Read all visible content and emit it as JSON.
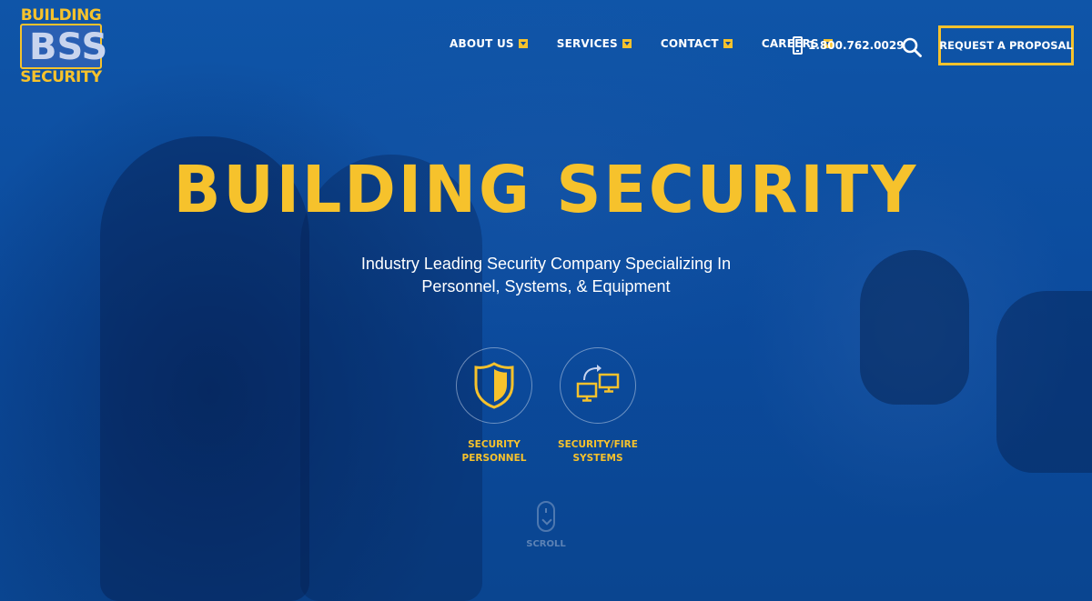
{
  "logo": {
    "top_text": "BUILDING",
    "monogram": "BSS",
    "bottom_text": "SECURITY"
  },
  "nav": {
    "items": [
      {
        "label": "ABOUT US"
      },
      {
        "label": "SERVICES"
      },
      {
        "label": "CONTACT"
      },
      {
        "label": "CAREERS"
      }
    ],
    "phone": "1.800.762.0029",
    "cta_label": "REQUEST A PROPOSAL"
  },
  "hero": {
    "title": "BUILDING SECURITY",
    "subtitle_line1": "Industry Leading Security Company Specializing In",
    "subtitle_line2": "Personnel, Systems, & Equipment"
  },
  "services": [
    {
      "label": "SECURITY\nPERSONNEL",
      "icon": "shield-icon"
    },
    {
      "label": "SECURITY/FIRE\nSYSTEMS",
      "icon": "monitors-icon"
    }
  ],
  "scroll_label": "SCROLL",
  "colors": {
    "accent": "#f6c22c",
    "background": "#0d4a9a",
    "text": "#ffffff"
  }
}
